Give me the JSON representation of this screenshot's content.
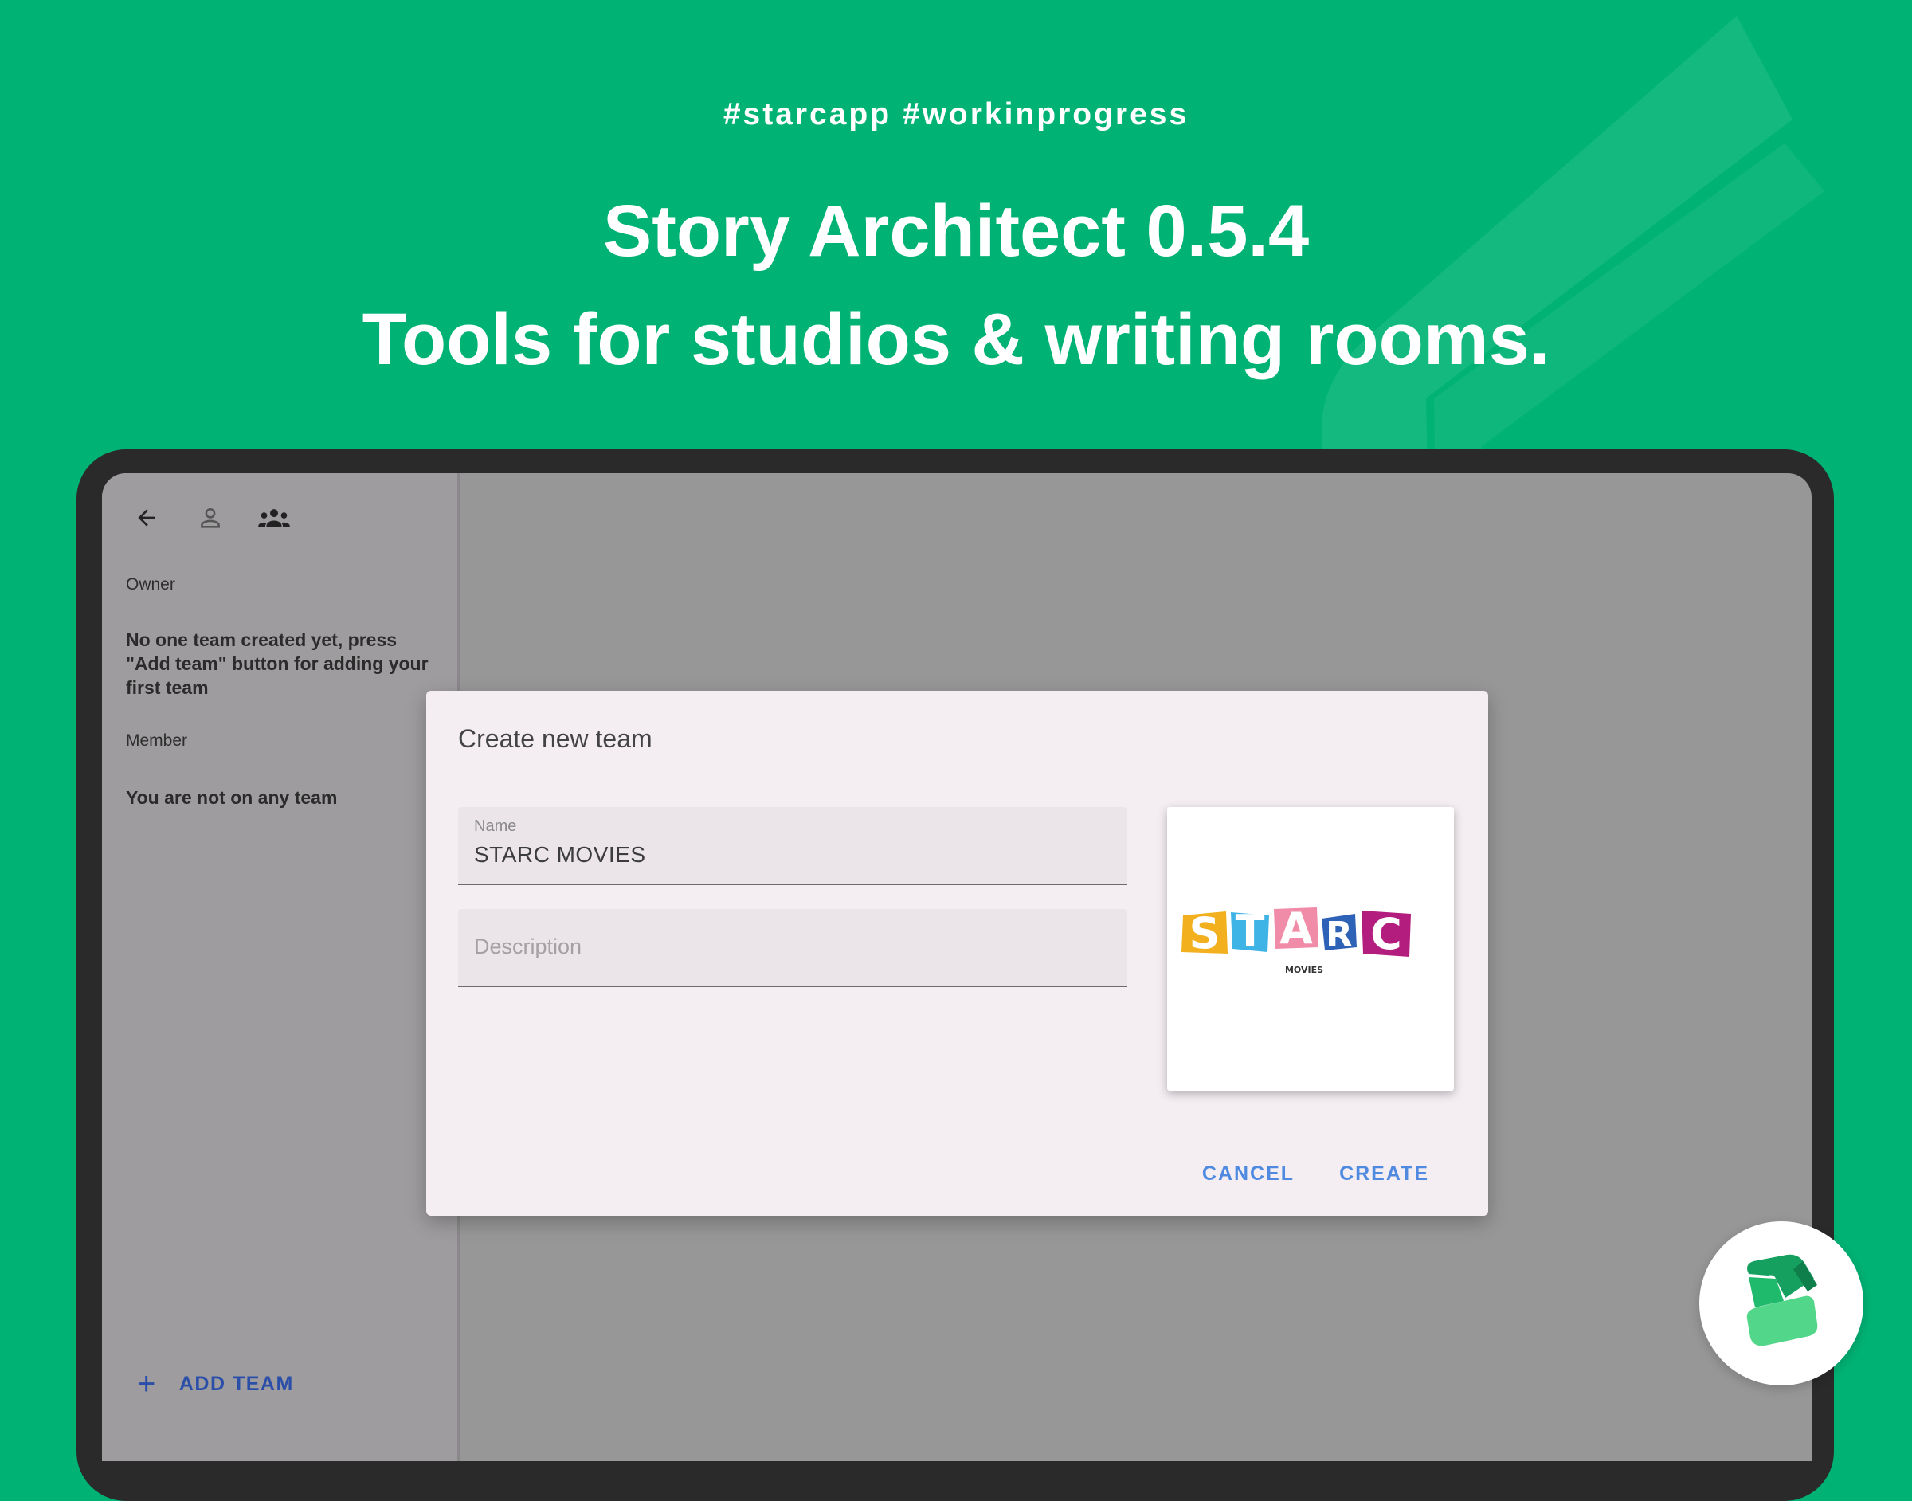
{
  "hero": {
    "hashtags": "#starcapp  #workinprogress",
    "title_line1": "Story Architect 0.5.4",
    "title_line2": "Tools for studios & writing rooms."
  },
  "sidebar": {
    "icons": [
      "back-arrow-icon",
      "person-icon",
      "team-icon"
    ],
    "owner_label": "Owner",
    "owner_empty_message": "No one team created yet, press \"Add team\" button for adding your first team",
    "member_label": "Member",
    "member_empty_message": "You are not on any team",
    "add_team_label": "ADD TEAM"
  },
  "dialog": {
    "title": "Create new team",
    "name_label": "Name",
    "name_value": "STARC MOVIES",
    "description_placeholder": "Description",
    "logo_letters": [
      "S",
      "T",
      "A",
      "R",
      "C"
    ],
    "logo_subtitle": "MOVIES",
    "cancel_label": "CANCEL",
    "create_label": "CREATE"
  },
  "colors": {
    "background": "#00B375",
    "accent_button": "#4F8AE0",
    "add_team": "#2B4FA8",
    "logo_s": "#F2B01E",
    "logo_t": "#3DB3E6",
    "logo_a": "#F08BA8",
    "logo_r": "#2E62B6",
    "logo_c": "#B21D7E"
  }
}
